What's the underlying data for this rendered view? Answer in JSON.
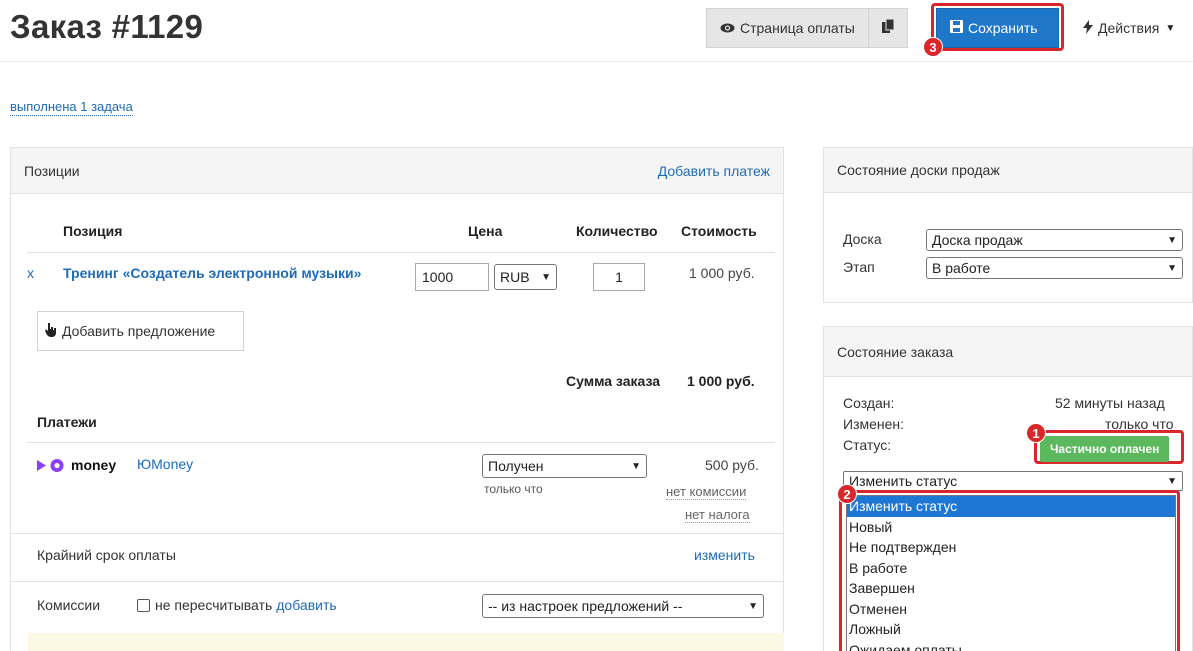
{
  "header": {
    "title": "Заказ #1129",
    "payment_page_label": "Страница оплаты",
    "save_label": "Сохранить",
    "actions_label": "Действия"
  },
  "task_link": "выполнена 1 задача",
  "positions_panel": {
    "title": "Позиции",
    "add_payment": "Добавить платеж",
    "columns": {
      "position": "Позиция",
      "price": "Цена",
      "qty": "Количество",
      "cost": "Стоимость"
    },
    "item": {
      "remove": "x",
      "name": "Тренинг «Создатель электронной музыки»",
      "price": "1000",
      "currency": "RUB",
      "qty": "1",
      "cost": "1 000 руб."
    },
    "add_offer": "Добавить предложение",
    "total_label": "Сумма заказа",
    "total_value": "1 000 руб."
  },
  "payments": {
    "title": "Платежи",
    "logo_text": "money",
    "provider": "ЮMoney",
    "status": "Получен",
    "time": "только что",
    "amount": "500 руб.",
    "no_commission": "нет комиссии",
    "no_tax": "нет налога",
    "deadline_label": "Крайний срок оплаты",
    "deadline_change": "изменить",
    "commission_label": "Комиссии",
    "no_recalc": "не пересчитывать",
    "add": "добавить",
    "commission_select": "-- из настроек предложений --"
  },
  "board_panel": {
    "title": "Состояние доски продаж",
    "board_label": "Доска",
    "board_value": "Доска продаж",
    "stage_label": "Этап",
    "stage_value": "В работе"
  },
  "order_panel": {
    "title": "Состояние заказа",
    "created_label": "Создан:",
    "created_value": "52 минуты назад",
    "changed_label": "Изменен:",
    "changed_value": "только что",
    "status_label": "Статус:",
    "status_value": "Частично оплачен",
    "change_status": "Изменить статус",
    "options": [
      "Изменить статус",
      "Новый",
      "Не подтвержден",
      "В работе",
      "Завершен",
      "Отменен",
      "Ложный",
      "Ожидаем оплаты"
    ]
  },
  "annotations": {
    "one": "1",
    "two": "2",
    "three": "3"
  },
  "colors": {
    "accent": "#1e77c9",
    "highlight": "#d9262b",
    "status": "#5cb85c",
    "link": "#1e6bb8"
  }
}
